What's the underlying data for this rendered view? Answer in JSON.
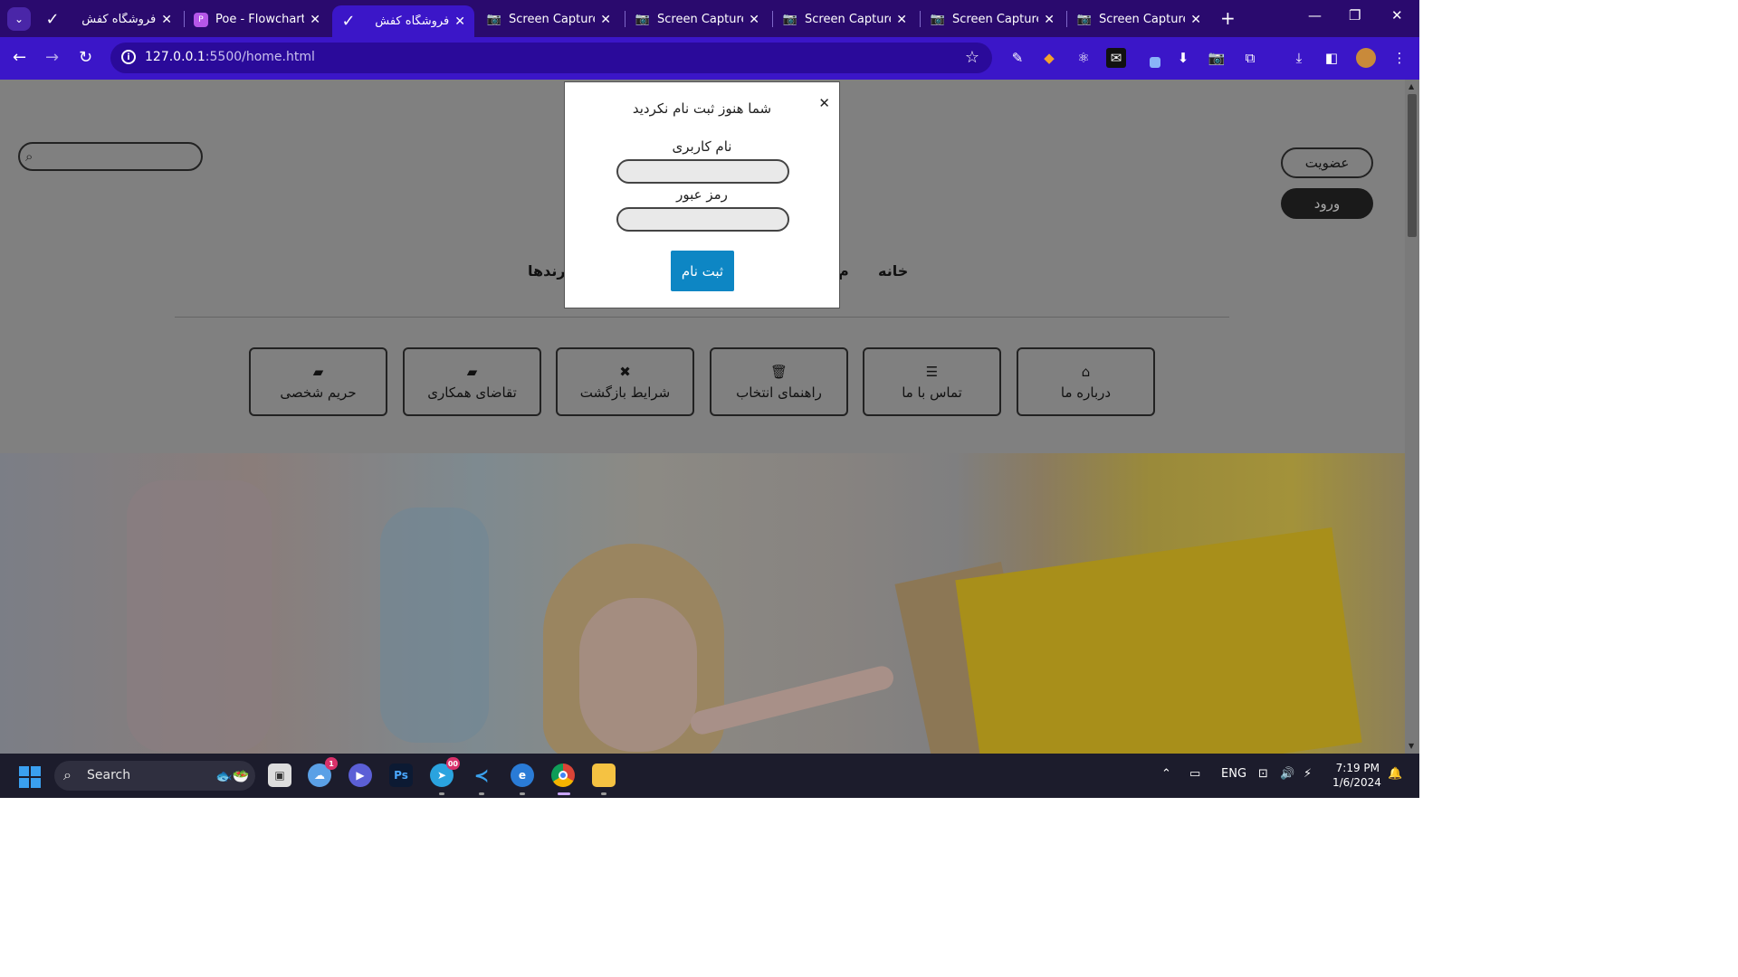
{
  "browser": {
    "tabs": [
      {
        "title": "فروشگاه کفش",
        "icon": "checkmark-icon",
        "active": false
      },
      {
        "title": "Poe - Flowchart S",
        "icon": "poe-icon",
        "active": false
      },
      {
        "title": "فروشگاه کفش",
        "icon": "checkmark-icon",
        "active": true
      },
      {
        "title": "Screen Capture F",
        "icon": "camera-icon",
        "active": false
      },
      {
        "title": "Screen Capture F",
        "icon": "camera-icon",
        "active": false
      },
      {
        "title": "Screen Capture F",
        "icon": "camera-icon",
        "active": false
      },
      {
        "title": "Screen Capture F",
        "icon": "camera-icon",
        "active": false
      },
      {
        "title": "Screen Capture F",
        "icon": "camera-icon",
        "active": false
      }
    ],
    "url_host": "127.0.0.1",
    "url_rest": ":5500/home.html",
    "accent": "#3b16c8",
    "tabbar_color": "#2a0a6e"
  },
  "page": {
    "member_button": "عضویت",
    "login_button": "ورود",
    "nav": {
      "home": "خانه",
      "partial": "م",
      "brands": "برندها"
    },
    "features": [
      {
        "label": "درباره ما",
        "icon": "home-icon"
      },
      {
        "label": "تماس با ما",
        "icon": "bars-icon"
      },
      {
        "label": "راهنمای انتخاب",
        "icon": "trash-icon"
      },
      {
        "label": "شرایط بازگشت",
        "icon": "close-icon"
      },
      {
        "label": "تقاضای همکاری",
        "icon": "folder-icon"
      },
      {
        "label": "حریم شخصی",
        "icon": "folder-icon"
      }
    ]
  },
  "modal": {
    "title": "شما هنوز ثبت نام نکردید",
    "username_label": "نام کاربری",
    "password_label": "رمز عبور",
    "submit": "ثبت نام",
    "submit_color": "#0d86c4"
  },
  "taskbar": {
    "search_label": "Search",
    "cloud_badge": "1",
    "telegram_badge": "00",
    "language": "ENG",
    "time": "7:19 PM",
    "date": "1/6/2024"
  }
}
